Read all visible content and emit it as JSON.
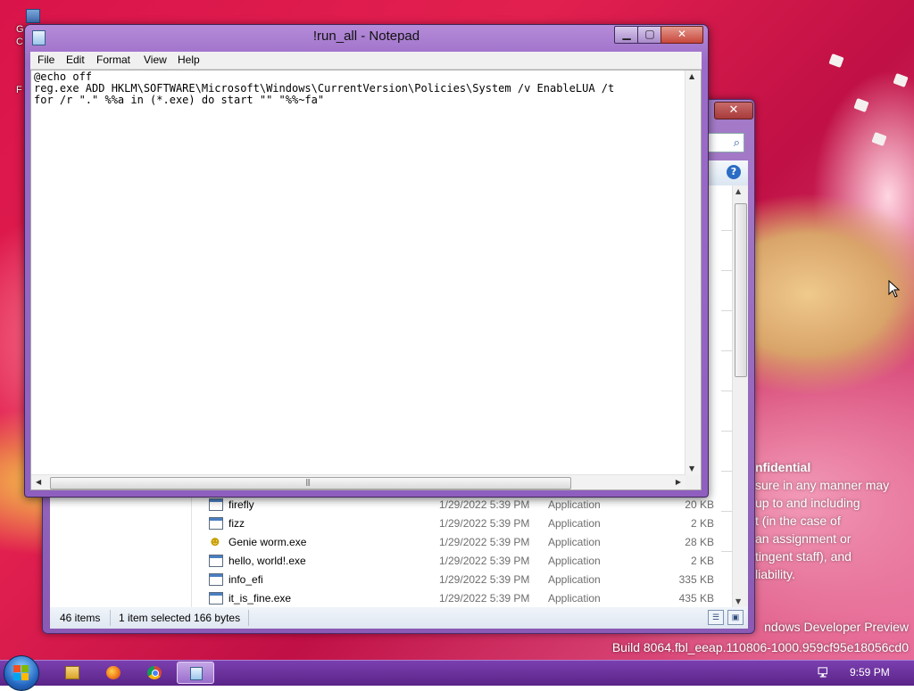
{
  "desktop": {
    "fragments": [
      "G",
      "C",
      "F"
    ],
    "watermark": {
      "line1": "ndows Developer Preview",
      "line2": "Build 8064.fbl_eeap.110806-1000.959cf95e18056cd0"
    },
    "confidential": {
      "title": "nfidential",
      "lines": [
        "sure in any manner may",
        "up to and including",
        "t (in the case of",
        "an assignment or",
        "tingent staff), and",
        "liability."
      ]
    }
  },
  "notepad": {
    "title": "!run_all - Notepad",
    "buttons": {
      "minimize": "▁",
      "maximize": "▢",
      "close": "✕"
    },
    "menu": [
      "File",
      "Edit",
      "Format",
      "View",
      "Help"
    ],
    "lines": [
      "@echo off",
      "reg.exe ADD HKLM\\SOFTWARE\\Microsoft\\Windows\\CurrentVersion\\Policies\\System /v EnableLUA /t",
      "for /r \".\" %%a in (*.exe) do start \"\" \"%%~fa\""
    ]
  },
  "explorer": {
    "close": "✕",
    "search_icon": "magnifier-icon",
    "help": "?",
    "files": [
      {
        "name": "firefly",
        "date": "1/29/2022 5:39 PM",
        "type": "Application",
        "size": "20 KB",
        "icon": "exe-icon"
      },
      {
        "name": "fizz",
        "date": "1/29/2022 5:39 PM",
        "type": "Application",
        "size": "2 KB",
        "icon": "exe-icon"
      },
      {
        "name": "Genie worm.exe",
        "date": "1/29/2022 5:39 PM",
        "type": "Application",
        "size": "28 KB",
        "icon": "smiley-icon"
      },
      {
        "name": "hello, world!.exe",
        "date": "1/29/2022 5:39 PM",
        "type": "Application",
        "size": "2 KB",
        "icon": "exe-icon"
      },
      {
        "name": "info_efi",
        "date": "1/29/2022 5:39 PM",
        "type": "Application",
        "size": "335 KB",
        "icon": "exe-icon"
      },
      {
        "name": "it_is_fine.exe",
        "date": "1/29/2022 5:39 PM",
        "type": "Application",
        "size": "435 KB",
        "icon": "exe-icon"
      }
    ],
    "status": {
      "items": "46 items",
      "selected": "1 item selected 166 bytes"
    }
  },
  "taskbar": {
    "buttons": [
      "file-explorer-icon",
      "firefox-icon",
      "chrome-icon",
      "notepad-icon"
    ],
    "clock": "9:59 PM"
  },
  "colors": {
    "window_frame": "#9b6cc7",
    "taskbar": "#6a2f9c",
    "close_button": "#c7473b"
  }
}
